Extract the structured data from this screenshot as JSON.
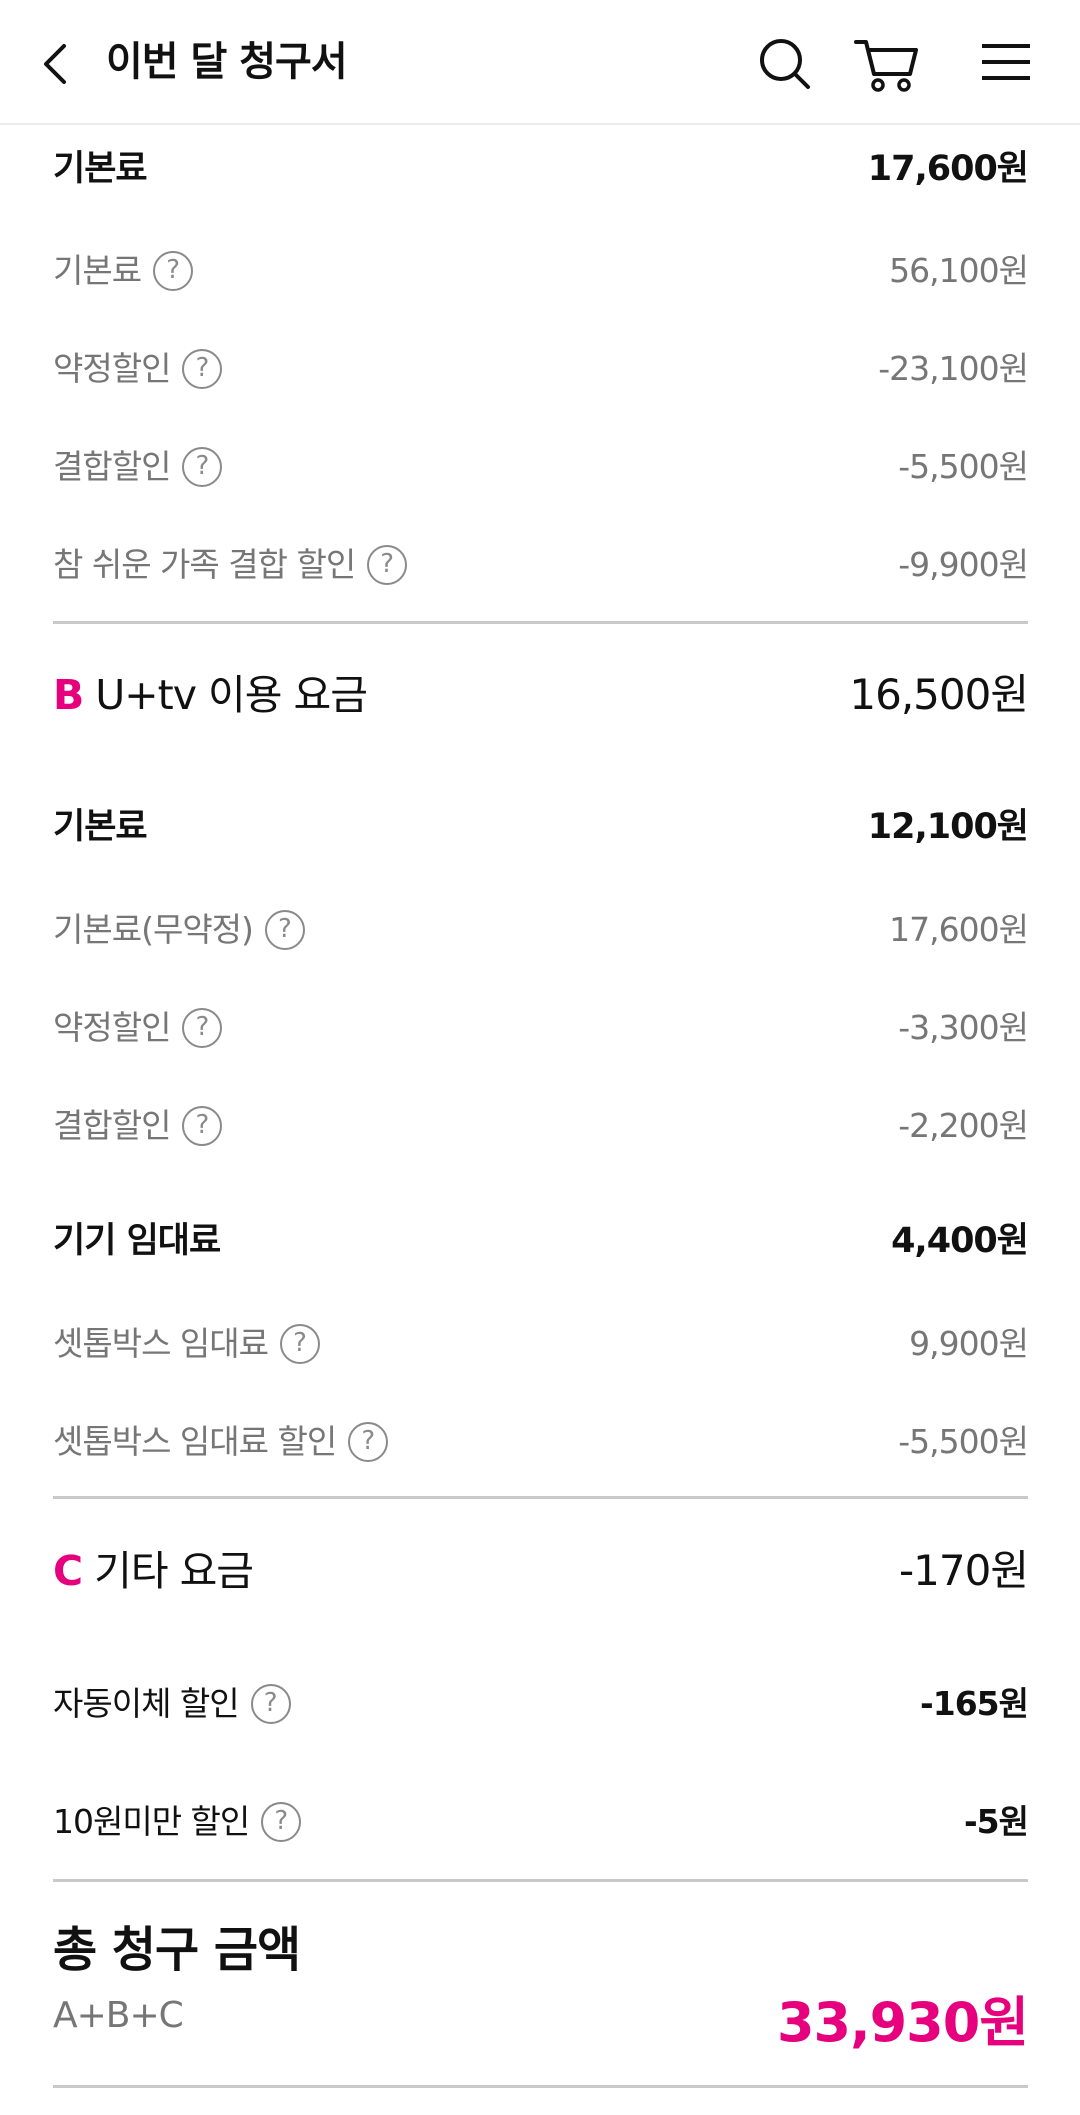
{
  "header": {
    "title": "이번 달 청구서",
    "icons": [
      "chevron-left-icon",
      "search-icon",
      "cart-icon",
      "menu-icon"
    ]
  },
  "colors": {
    "accent": "#e6007e",
    "sub_text": "#767676",
    "divider": "#c9c9c9"
  },
  "section_a": {
    "basic_fee": {
      "label": "기본료",
      "amount": "17,600원"
    },
    "items": [
      {
        "label": "기본료",
        "amount": "56,100원"
      },
      {
        "label": "약정할인",
        "amount": "-23,100원"
      },
      {
        "label": "결합할인",
        "amount": "-5,500원"
      },
      {
        "label": "참 쉬운 가족 결합 할인",
        "amount": "-9,900원"
      }
    ]
  },
  "section_b": {
    "letter": "B",
    "title": "U+tv 이용 요금",
    "amount": "16,500원",
    "basic_fee": {
      "label": "기본료",
      "amount": "12,100원"
    },
    "basic_items": [
      {
        "label": "기본료(무약정)",
        "amount": "17,600원"
      },
      {
        "label": "약정할인",
        "amount": "-3,300원"
      },
      {
        "label": "결합할인",
        "amount": "-2,200원"
      }
    ],
    "rental": {
      "label": "기기 임대료",
      "amount": "4,400원"
    },
    "rental_items": [
      {
        "label": "셋톱박스 임대료",
        "amount": "9,900원"
      },
      {
        "label": "셋톱박스 임대료 할인",
        "amount": "-5,500원"
      }
    ]
  },
  "section_c": {
    "letter": "C",
    "title": "기타 요금",
    "amount": "-170원",
    "items": [
      {
        "label": "자동이체 할인",
        "amount": "-165원"
      },
      {
        "label": "10원미만 할인",
        "amount": "-5원"
      }
    ]
  },
  "total": {
    "title": "총 청구 금액",
    "formula": "A+B+C",
    "amount": "33,930원"
  },
  "help_glyph": "?"
}
